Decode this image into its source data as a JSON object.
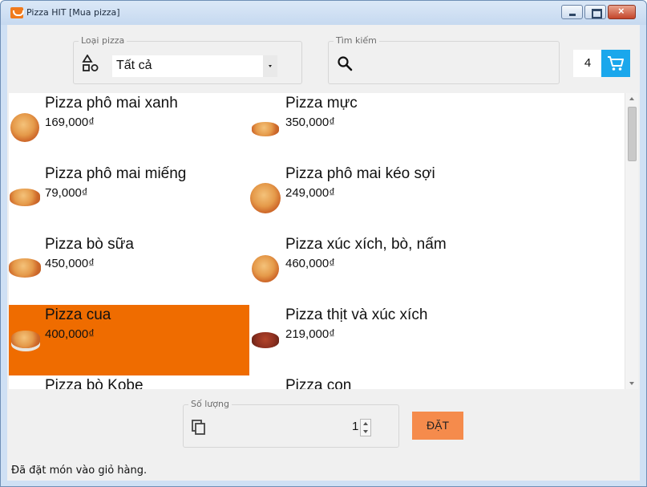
{
  "window": {
    "title": "Pizza HIT [Mua pizza]"
  },
  "filter": {
    "label": "Loại pizza",
    "selected": "Tất cả"
  },
  "search": {
    "label": "Tìm kiếm",
    "value": ""
  },
  "cart": {
    "count": "4"
  },
  "products": [
    {
      "name": "Pizza phô mai xanh",
      "price": "169,000₫"
    },
    {
      "name": "Pizza mực",
      "price": "350,000₫"
    },
    {
      "name": "Pizza phô mai miếng",
      "price": "79,000₫"
    },
    {
      "name": "Pizza phô mai kéo sợi",
      "price": "249,000₫"
    },
    {
      "name": "Pizza bò sữa",
      "price": "450,000₫"
    },
    {
      "name": "Pizza xúc xích, bò, nấm",
      "price": "460,000₫"
    },
    {
      "name": "Pizza cua",
      "price": "400,000₫",
      "selected": true
    },
    {
      "name": "Pizza thịt và xúc xích",
      "price": "219,000₫"
    },
    {
      "name": "Pizza bò Kobe",
      "price": ""
    },
    {
      "name": "Pizza con",
      "price": ""
    }
  ],
  "quantity": {
    "label": "Số lượng",
    "value": "1"
  },
  "order_button": {
    "label": "ĐẶT"
  },
  "status_bar": {
    "message": "Đã đặt món vào giỏ hàng."
  },
  "colors": {
    "selected_item": "#ef6c00",
    "cart_button": "#1aa7ec",
    "order_button": "#f58b4c"
  }
}
